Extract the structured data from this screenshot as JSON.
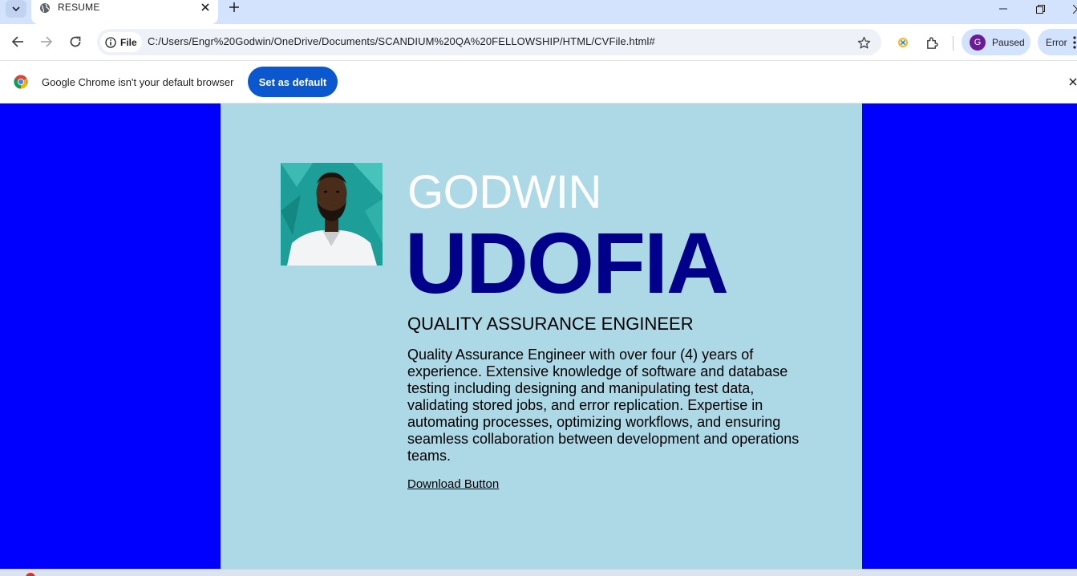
{
  "browser": {
    "tab": {
      "title": "RESUME"
    },
    "address_bar": {
      "site_chip_label": "File",
      "url": "C:/Users/Engr%20Godwin/OneDrive/Documents/SCANDIUM%20QA%20FELLOWSHIP/HTML/CVFile.html#"
    },
    "profile": {
      "avatar_letter": "G",
      "status": "Paused"
    },
    "error_chip": "Error",
    "infobar": {
      "message": "Google Chrome isn't your default browser",
      "button_label": "Set as default"
    }
  },
  "resume": {
    "first_name": "GODWIN",
    "last_name": "UDOFIA",
    "job_title": "QUALITY ASSURANCE ENGINEER",
    "summary": "Quality Assurance Engineer with over four (4) years of experience. Extensive knowledge of software and database testing including designing and manipulating test data, validating stored jobs, and error replication. Expertise in automating processes, optimizing workflows, and ensuring seamless collaboration between development and operations teams.",
    "download_label": "Download Button"
  },
  "colors": {
    "page_background": "#0000ff",
    "card_background": "#add8e6",
    "first_name": "#ffffff",
    "last_name": "#00008b",
    "set_default_button": "#0b57d0",
    "tab_strip": "#d3e3fd"
  }
}
